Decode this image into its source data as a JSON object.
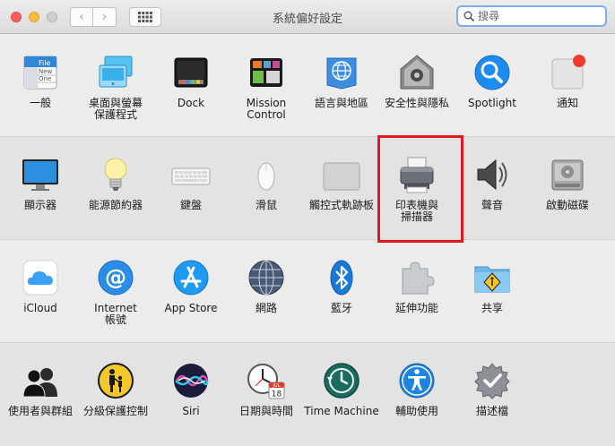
{
  "window": {
    "title": "系統偏好設定",
    "search_placeholder": "搜尋",
    "back_symbol": "‹",
    "forward_symbol": "›"
  },
  "rows": [
    [
      {
        "label": "一般",
        "icon": "general-icon"
      },
      {
        "label": "桌面與螢幕\n保護程式",
        "icon": "desktop-screensaver-icon"
      },
      {
        "label": "Dock",
        "icon": "dock-icon"
      },
      {
        "label": "Mission\nControl",
        "icon": "mission-control-icon"
      },
      {
        "label": "語言與地區",
        "icon": "language-region-icon"
      },
      {
        "label": "安全性與隱私",
        "icon": "security-privacy-icon"
      },
      {
        "label": "Spotlight",
        "icon": "spotlight-icon"
      },
      {
        "label": "通知",
        "icon": "notifications-icon"
      }
    ],
    [
      {
        "label": "顯示器",
        "icon": "displays-icon"
      },
      {
        "label": "能源節約器",
        "icon": "energy-saver-icon"
      },
      {
        "label": "鍵盤",
        "icon": "keyboard-icon"
      },
      {
        "label": "滑鼠",
        "icon": "mouse-icon"
      },
      {
        "label": "觸控式軌跡板",
        "icon": "trackpad-icon"
      },
      {
        "label": "印表機與\n掃描器",
        "icon": "printer-icon"
      },
      {
        "label": "聲音",
        "icon": "sound-icon"
      },
      {
        "label": "啟動磁碟",
        "icon": "startup-disk-icon"
      }
    ],
    [
      {
        "label": "iCloud",
        "icon": "icloud-icon"
      },
      {
        "label": "Internet\n帳號",
        "icon": "internet-accounts-icon"
      },
      {
        "label": "App Store",
        "icon": "app-store-icon"
      },
      {
        "label": "網路",
        "icon": "network-icon"
      },
      {
        "label": "藍牙",
        "icon": "bluetooth-icon"
      },
      {
        "label": "延伸功能",
        "icon": "extensions-icon"
      },
      {
        "label": "共享",
        "icon": "sharing-icon"
      }
    ],
    [
      {
        "label": "使用者與群組",
        "icon": "users-groups-icon"
      },
      {
        "label": "分級保護控制",
        "icon": "parental-controls-icon"
      },
      {
        "label": "Siri",
        "icon": "siri-icon"
      },
      {
        "label": "日期與時間",
        "icon": "date-time-icon"
      },
      {
        "label": "Time Machine",
        "icon": "time-machine-icon"
      },
      {
        "label": "輔助使用",
        "icon": "accessibility-icon"
      },
      {
        "label": "描述檔",
        "icon": "profiles-icon"
      }
    ]
  ],
  "icon_text": {
    "general_file": "File",
    "general_new": "New",
    "general_one": "One",
    "calendar_month": "JUL",
    "calendar_day": "18"
  },
  "colors": {
    "highlight": "#e0191e",
    "search_focus": "#7cadf3",
    "accent_blue": "#1d8cf0"
  }
}
